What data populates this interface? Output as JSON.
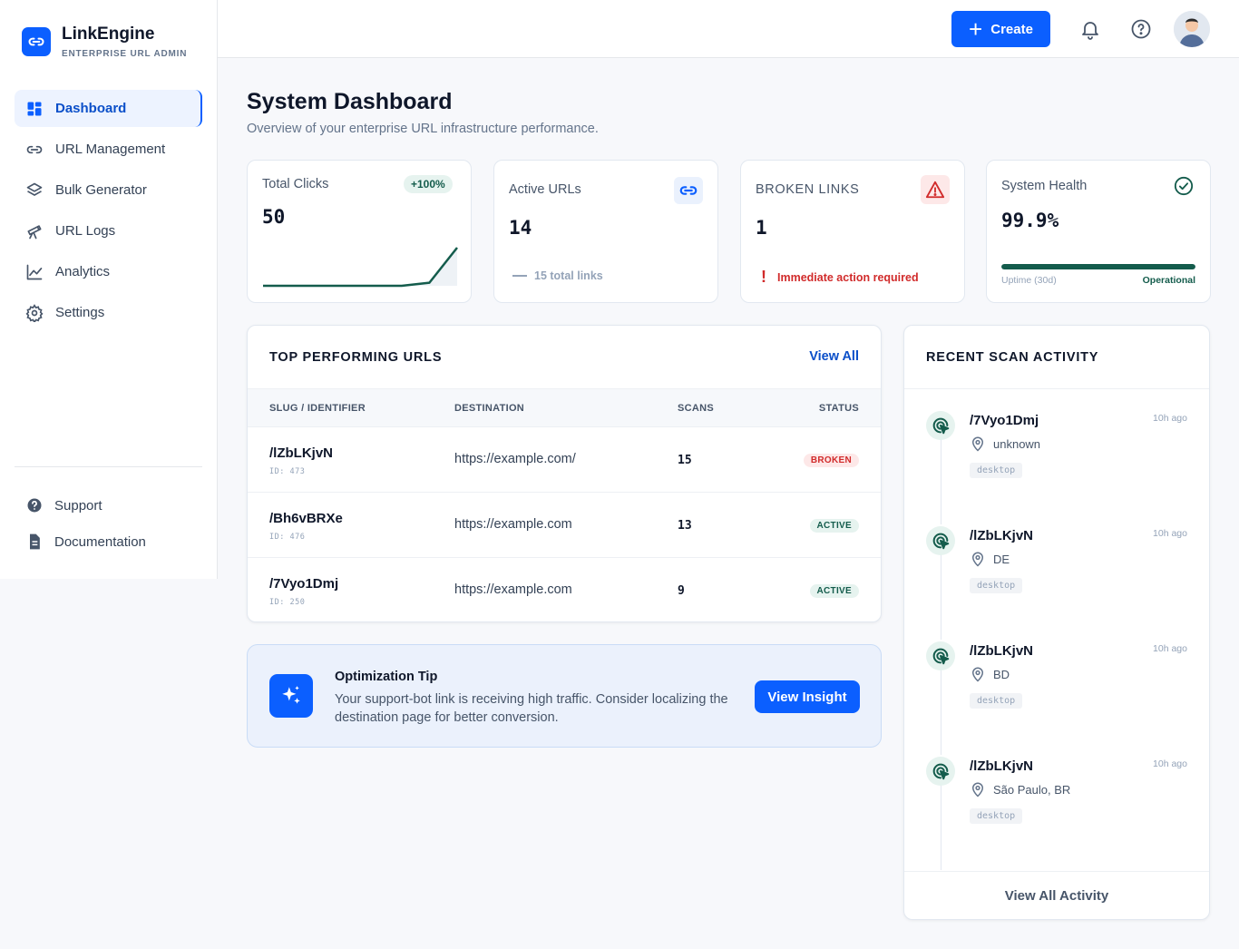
{
  "brand": {
    "name": "LinkEngine",
    "subtitle": "ENTERPRISE URL ADMIN"
  },
  "sidebar": {
    "items": [
      {
        "label": "Dashboard",
        "icon": "dashboard-icon",
        "active": true
      },
      {
        "label": "URL Management",
        "icon": "link-icon"
      },
      {
        "label": "Bulk Generator",
        "icon": "layers-icon"
      },
      {
        "label": "URL Logs",
        "icon": "telescope-icon"
      },
      {
        "label": "Analytics",
        "icon": "chart-line-icon"
      },
      {
        "label": "Settings",
        "icon": "gear-icon"
      }
    ],
    "footer": [
      {
        "label": "Support",
        "icon": "help-circle-icon"
      },
      {
        "label": "Documentation",
        "icon": "document-icon"
      }
    ]
  },
  "topbar": {
    "create_label": "Create"
  },
  "page": {
    "title": "System Dashboard",
    "subtitle": "Overview of your enterprise URL infrastructure performance."
  },
  "stats": {
    "total_clicks": {
      "label": "Total Clicks",
      "value": "50",
      "badge": "+100%",
      "trend": [
        0,
        0,
        0,
        0,
        0,
        0,
        0.08,
        1
      ]
    },
    "active_urls": {
      "label": "Active URLs",
      "value": "14",
      "note": "15 total links"
    },
    "broken_links": {
      "label": "BROKEN LINKS",
      "value": "1",
      "note": "Immediate action required"
    },
    "system_health": {
      "label": "System Health",
      "value": "99.9%",
      "uptime_label": "Uptime (30d)",
      "status": "Operational",
      "uptime_fraction": 0.999
    }
  },
  "top_urls": {
    "title": "TOP PERFORMING URLS",
    "view_all": "View All",
    "columns": [
      "SLUG / IDENTIFIER",
      "DESTINATION",
      "SCANS",
      "STATUS"
    ],
    "rows": [
      {
        "slug": "/lZbLKjvN",
        "id": "ID: 473",
        "destination": "https://example.com/",
        "scans": "15",
        "status": "BROKEN"
      },
      {
        "slug": "/Bh6vBRXe",
        "id": "ID: 476",
        "destination": "https://example.com",
        "scans": "13",
        "status": "ACTIVE"
      },
      {
        "slug": "/7Vyo1Dmj",
        "id": "ID: 250",
        "destination": "https://example.com",
        "scans": "9",
        "status": "ACTIVE"
      }
    ]
  },
  "tip": {
    "title": "Optimization Tip",
    "text": "Your support-bot link is receiving high traffic. Consider localizing the destination page for better conversion.",
    "button": "View Insight"
  },
  "activity": {
    "title": "RECENT SCAN ACTIVITY",
    "items": [
      {
        "slug": "/7Vyo1Dmj",
        "time": "10h ago",
        "location": "unknown",
        "device": "desktop"
      },
      {
        "slug": "/lZbLKjvN",
        "time": "10h ago",
        "location": "DE",
        "device": "desktop"
      },
      {
        "slug": "/lZbLKjvN",
        "time": "10h ago",
        "location": "BD",
        "device": "desktop"
      },
      {
        "slug": "/lZbLKjvN",
        "time": "10h ago",
        "location": "São Paulo, BR",
        "device": "desktop"
      }
    ],
    "footer": "View All Activity"
  },
  "colors": {
    "primary": "#0b5fff",
    "success": "#145c4c",
    "danger": "#d12b2b"
  }
}
